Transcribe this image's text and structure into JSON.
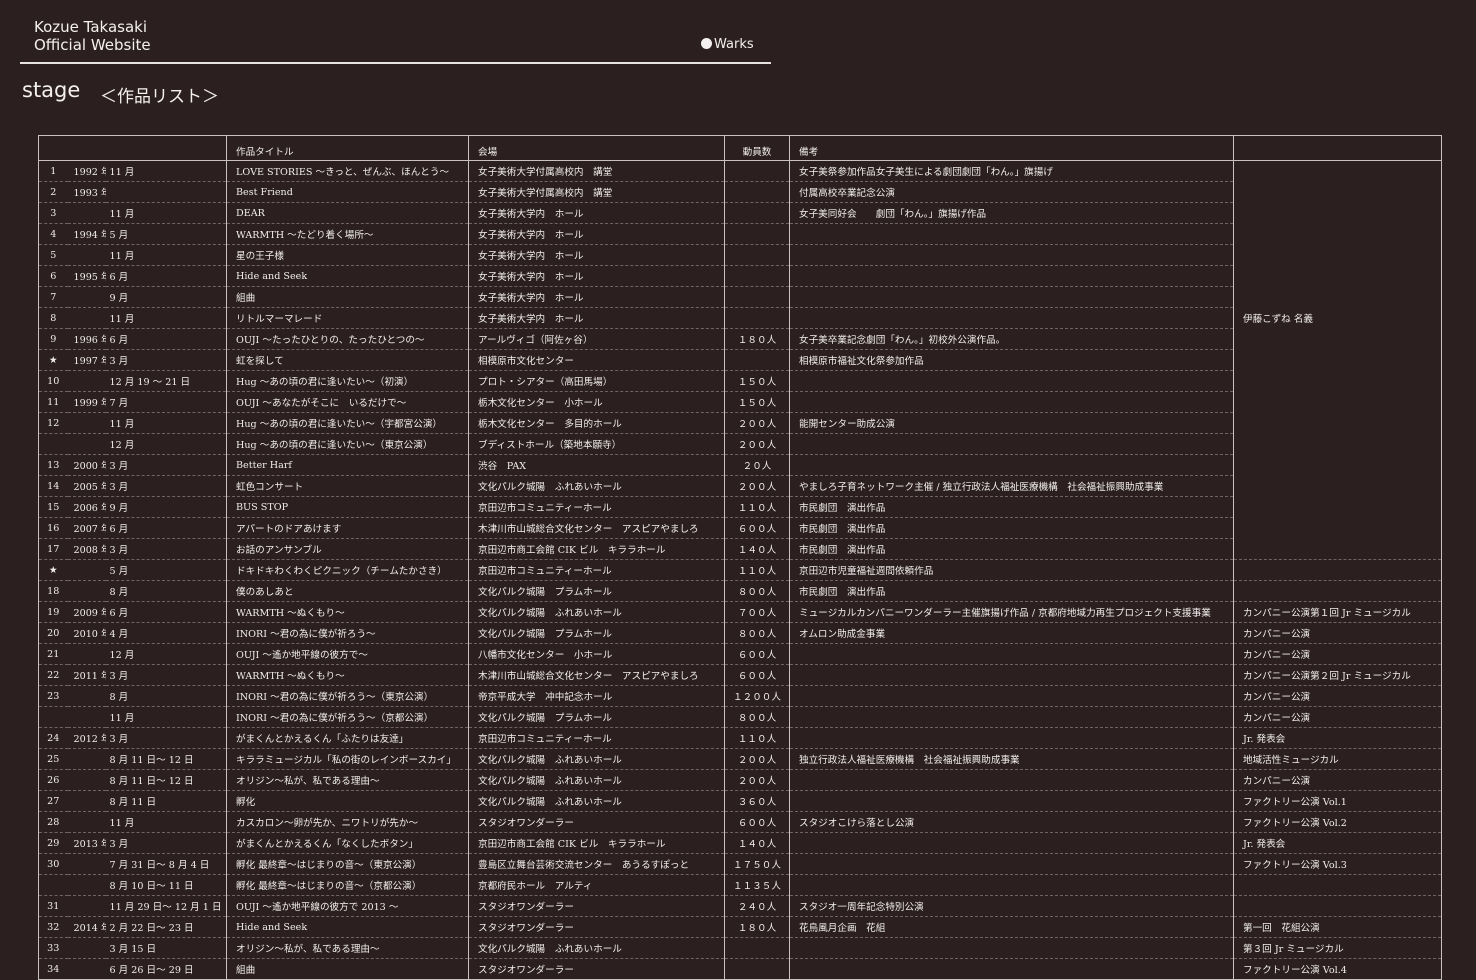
{
  "site": {
    "title_line1": "Kozue Takasaki",
    "title_line2": "Official Website",
    "nav_works": "Warks"
  },
  "page": {
    "section": "stage",
    "subtitle": "＜作品リスト＞"
  },
  "table": {
    "headers": {
      "no": "",
      "year": "",
      "month": "",
      "title": "作品タイトル",
      "venue": "会場",
      "attendance": "動員数",
      "notes": "備考",
      "notes2": ""
    },
    "rows": [
      {
        "no": "1",
        "year": "1992 年",
        "month": "11 月",
        "title": "LOVE STORIES 〜きっと、ぜんぶ、ほんとう〜",
        "venue": "女子美術大学付属高校内　講堂",
        "attendance": "",
        "notes": "女子美祭参加作品女子美生による劇団劇団「わん。」旗揚げ",
        "notes2": ""
      },
      {
        "no": "2",
        "year": "1993 年",
        "month": "",
        "title": "Best Friend",
        "venue": "女子美術大学付属高校内　講堂",
        "attendance": "",
        "notes": "付属高校卒業記念公演",
        "notes2": ""
      },
      {
        "no": "3",
        "year": "",
        "month": "11 月",
        "title": "DEAR",
        "venue": "女子美術大学内　ホール",
        "attendance": "",
        "notes": "女子美同好会　　劇団「わん。」旗揚げ作品",
        "notes2": ""
      },
      {
        "no": "4",
        "year": "1994 年",
        "month": "5 月",
        "title": "WARMTH 〜たどり着く場所〜",
        "venue": "女子美術大学内　ホール",
        "attendance": "",
        "notes": "",
        "notes2": ""
      },
      {
        "no": "5",
        "year": "",
        "month": "11 月",
        "title": "星の王子様",
        "venue": "女子美術大学内　ホール",
        "attendance": "",
        "notes": "",
        "notes2": ""
      },
      {
        "no": "6",
        "year": "1995 年",
        "month": "6 月",
        "title": "Hide and Seek",
        "venue": "女子美術大学内　ホール",
        "attendance": "",
        "notes": "",
        "notes2": ""
      },
      {
        "no": "7",
        "year": "",
        "month": "9 月",
        "title": "組曲",
        "venue": "女子美術大学内　ホール",
        "attendance": "",
        "notes": "",
        "notes2": ""
      },
      {
        "no": "8",
        "year": "",
        "month": "11 月",
        "title": "リトルマーマレード",
        "venue": "女子美術大学内　ホール",
        "attendance": "",
        "notes": "",
        "notes2": "伊藤こずね 名義"
      },
      {
        "no": "9",
        "year": "1996 年",
        "month": "6 月",
        "title": "OUJI 〜たったひとりの、たったひとつの〜",
        "venue": "アールヴィゴ（阿佐ヶ谷）",
        "attendance": "１８０人",
        "notes": "女子美卒業記念劇団「わん。」初校外公演作品。",
        "notes2": ""
      },
      {
        "no": "★",
        "year": "1997 年",
        "month": "3 月",
        "title": "虹を探して",
        "venue": "相模原市文化センター",
        "attendance": "",
        "notes": "相模原市福祉文化祭参加作品",
        "notes2": ""
      },
      {
        "no": "10",
        "year": "",
        "month": "12 月 19 〜 21 日",
        "title": "Hug 〜あの頃の君に逢いたい〜（初演）",
        "venue": "プロト・シアター（高田馬場）",
        "attendance": "１５０人",
        "notes": "",
        "notes2": ""
      },
      {
        "no": "11",
        "year": "1999 年",
        "month": "7 月",
        "title": "OUJI 〜あなたがそこに　いるだけで〜",
        "venue": "栃木文化センター　小ホール",
        "attendance": "１５０人",
        "notes": "",
        "notes2": ""
      },
      {
        "no": "12",
        "year": "",
        "month": "11 月",
        "title": "Hug 〜あの頃の君に逢いたい〜（宇都宮公演）",
        "venue": "栃木文化センター　多目的ホール",
        "attendance": "２００人",
        "notes": "能開センター助成公演",
        "notes2": ""
      },
      {
        "no": "",
        "year": "",
        "month": "12 月",
        "title": "Hug 〜あの頃の君に逢いたい〜（東京公演）",
        "venue": "ブディストホール（築地本願寺）",
        "attendance": "２００人",
        "notes": "",
        "notes2": ""
      },
      {
        "no": "13",
        "year": "2000 年",
        "month": "3 月",
        "title": "Better Harf",
        "venue": "渋谷　PAX",
        "attendance": "２０人",
        "notes": "",
        "notes2": ""
      },
      {
        "no": "14",
        "year": "2005 年",
        "month": "3 月",
        "title": "虹色コンサート",
        "venue": "文化パルク城陽　ふれあいホール",
        "attendance": "２００人",
        "notes": "やましろ子育ネットワーク主催 / 独立行政法人福祉医療機構　社会福祉振興助成事業",
        "notes2": ""
      },
      {
        "no": "15",
        "year": "2006 年",
        "month": "9 月",
        "title": "BUS STOP",
        "venue": "京田辺市コミュニティーホール",
        "attendance": "１１０人",
        "notes": "市民劇団　演出作品",
        "notes2": ""
      },
      {
        "no": "16",
        "year": "2007 年",
        "month": "6 月",
        "title": "アパートのドアあけます",
        "venue": "木津川市山城総合文化センター　アスピアやましろ",
        "attendance": "６００人",
        "notes": "市民劇団　演出作品",
        "notes2": ""
      },
      {
        "no": "17",
        "year": "2008 年",
        "month": "3 月",
        "title": "お話のアンサンブル",
        "venue": "京田辺市商工会館 CIK ビル　キララホール",
        "attendance": "１４０人",
        "notes": "市民劇団　演出作品",
        "notes2": ""
      },
      {
        "no": "★",
        "year": "",
        "month": "5 月",
        "title": "ドキドキわくわくピクニック（チームたかさき）",
        "venue": "京田辺市コミュニティーホール",
        "attendance": "１１０人",
        "notes": "京田辺市児童福祉週間依頼作品",
        "notes2": ""
      },
      {
        "no": "18",
        "year": "",
        "month": "8 月",
        "title": "僕のあしあと",
        "venue": "文化パルク城陽　プラムホール",
        "attendance": "８００人",
        "notes": "市民劇団　演出作品",
        "notes2": ""
      },
      {
        "no": "19",
        "year": "2009 年",
        "month": "6 月",
        "title": "WARMTH 〜ぬくもり〜",
        "venue": "文化パルク城陽　ふれあいホール",
        "attendance": "７００人",
        "notes": "ミュージカルカンパニーワンダーラー主催旗揚げ作品 / 京都府地域力再生プロジェクト支援事業",
        "notes2": "カンパニー公演第１回 Jr ミュージカル"
      },
      {
        "no": "20",
        "year": "2010 年",
        "month": "4 月",
        "title": "INORI 〜君の為に僕が祈ろう〜",
        "venue": "文化パルク城陽　プラムホール",
        "attendance": "８００人",
        "notes": "オムロン助成金事業",
        "notes2": "カンパニー公演"
      },
      {
        "no": "21",
        "year": "",
        "month": "12 月",
        "title": "OUJI 〜遙か地平線の彼方で〜",
        "venue": "八幡市文化センター　小ホール",
        "attendance": "６００人",
        "notes": "",
        "notes2": "カンパニー公演"
      },
      {
        "no": "22",
        "year": "2011 年",
        "month": "3 月",
        "title": "WARMTH 〜ぬくもり〜",
        "venue": "木津川市山城総合文化センター　アスピアやましろ",
        "attendance": "６００人",
        "notes": "",
        "notes2": "カンパニー公演第２回 Jr ミュージカル"
      },
      {
        "no": "23",
        "year": "",
        "month": "8 月",
        "title": "INORI 〜君の為に僕が祈ろう〜（東京公演）",
        "venue": "帝京平成大学　冲中記念ホール",
        "attendance": "１２００人",
        "notes": "",
        "notes2": "カンパニー公演"
      },
      {
        "no": "",
        "year": "",
        "month": "11 月",
        "title": "INORI 〜君の為に僕が祈ろう〜（京都公演）",
        "venue": "文化パルク城陽　プラムホール",
        "attendance": "８００人",
        "notes": "",
        "notes2": "カンパニー公演"
      },
      {
        "no": "24",
        "year": "2012 年",
        "month": "3 月",
        "title": "がまくんとかえるくん「ふたりは友達」",
        "venue": "京田辺市コミュニティーホール",
        "attendance": "１１０人",
        "notes": "",
        "notes2": "Jr. 発表会"
      },
      {
        "no": "25",
        "year": "",
        "month": "8 月 11 日〜 12 日",
        "title": "キララミュージカル「私の街のレインボースカイ」",
        "venue": "文化パルク城陽　ふれあいホール",
        "attendance": "２００人",
        "notes": "独立行政法人福祉医療機構　社会福祉振興助成事業",
        "notes2": "地域活性ミュージカル"
      },
      {
        "no": "26",
        "year": "",
        "month": "8 月 11 日〜 12 日",
        "title": "オリジン〜私が、私である理由〜",
        "venue": "文化パルク城陽　ふれあいホール",
        "attendance": "２００人",
        "notes": "",
        "notes2": "カンパニー公演"
      },
      {
        "no": "27",
        "year": "",
        "month": "8 月 11 日",
        "title": "孵化",
        "venue": "文化パルク城陽　ふれあいホール",
        "attendance": "３６０人",
        "notes": "",
        "notes2": "ファクトリー公演 Vol.1"
      },
      {
        "no": "28",
        "year": "",
        "month": "11 月",
        "title": "カスカロン〜卵が先か、ニワトリが先か〜",
        "venue": "スタジオワンダーラー",
        "attendance": "６００人",
        "notes": "スタジオこけら落とし公演",
        "notes2": "ファクトリー公演 Vol.2"
      },
      {
        "no": "29",
        "year": "2013 年",
        "month": "3 月",
        "title": "がまくんとかえるくん「なくしたボタン」",
        "venue": "京田辺市商工会館 CIK ビル　キララホール",
        "attendance": "１４０人",
        "notes": "",
        "notes2": "Jr. 発表会"
      },
      {
        "no": "30",
        "year": "",
        "month": "7 月 31 日〜 8 月 4 日",
        "title": "孵化 最終章〜はじまりの音〜（東京公演）",
        "venue": "豊島区立舞台芸術交流センター　あうるすぽっと",
        "attendance": "１７５０人",
        "notes": "",
        "notes2": "ファクトリー公演 Vol.3"
      },
      {
        "no": "",
        "year": "",
        "month": "8 月 10 日〜 11 日",
        "title": "孵化 最終章〜はじまりの音〜（京都公演）",
        "venue": "京都府民ホール　アルティ",
        "attendance": "１１３５人",
        "notes": "",
        "notes2": ""
      },
      {
        "no": "31",
        "year": "",
        "month": "11 月 29 日〜 12 月 1 日",
        "title": "OUJI 〜遙か地平線の彼方で 2013 〜",
        "venue": "スタジオワンダーラー",
        "attendance": "２４０人",
        "notes": "スタジオ一周年記念特別公演",
        "notes2": ""
      },
      {
        "no": "32",
        "year": "2014 年",
        "month": "2 月 22 日〜 23 日",
        "title": "Hide and Seek",
        "venue": "スタジオワンダーラー",
        "attendance": "１８０人",
        "notes": "花鳥風月企画　花組",
        "notes2": "第一回　花組公演"
      },
      {
        "no": "33",
        "year": "",
        "month": "3 月 15 日",
        "title": "オリジン〜私が、私である理由〜",
        "venue": "文化パルク城陽　ふれあいホール",
        "attendance": "",
        "notes": "",
        "notes2": "第３回 Jr ミュージカル"
      },
      {
        "no": "34",
        "year": "",
        "month": "6 月 26 日〜 29 日",
        "title": "組曲",
        "venue": "スタジオワンダーラー",
        "attendance": "",
        "notes": "",
        "notes2": "ファクトリー公演 Vol.4"
      }
    ]
  }
}
